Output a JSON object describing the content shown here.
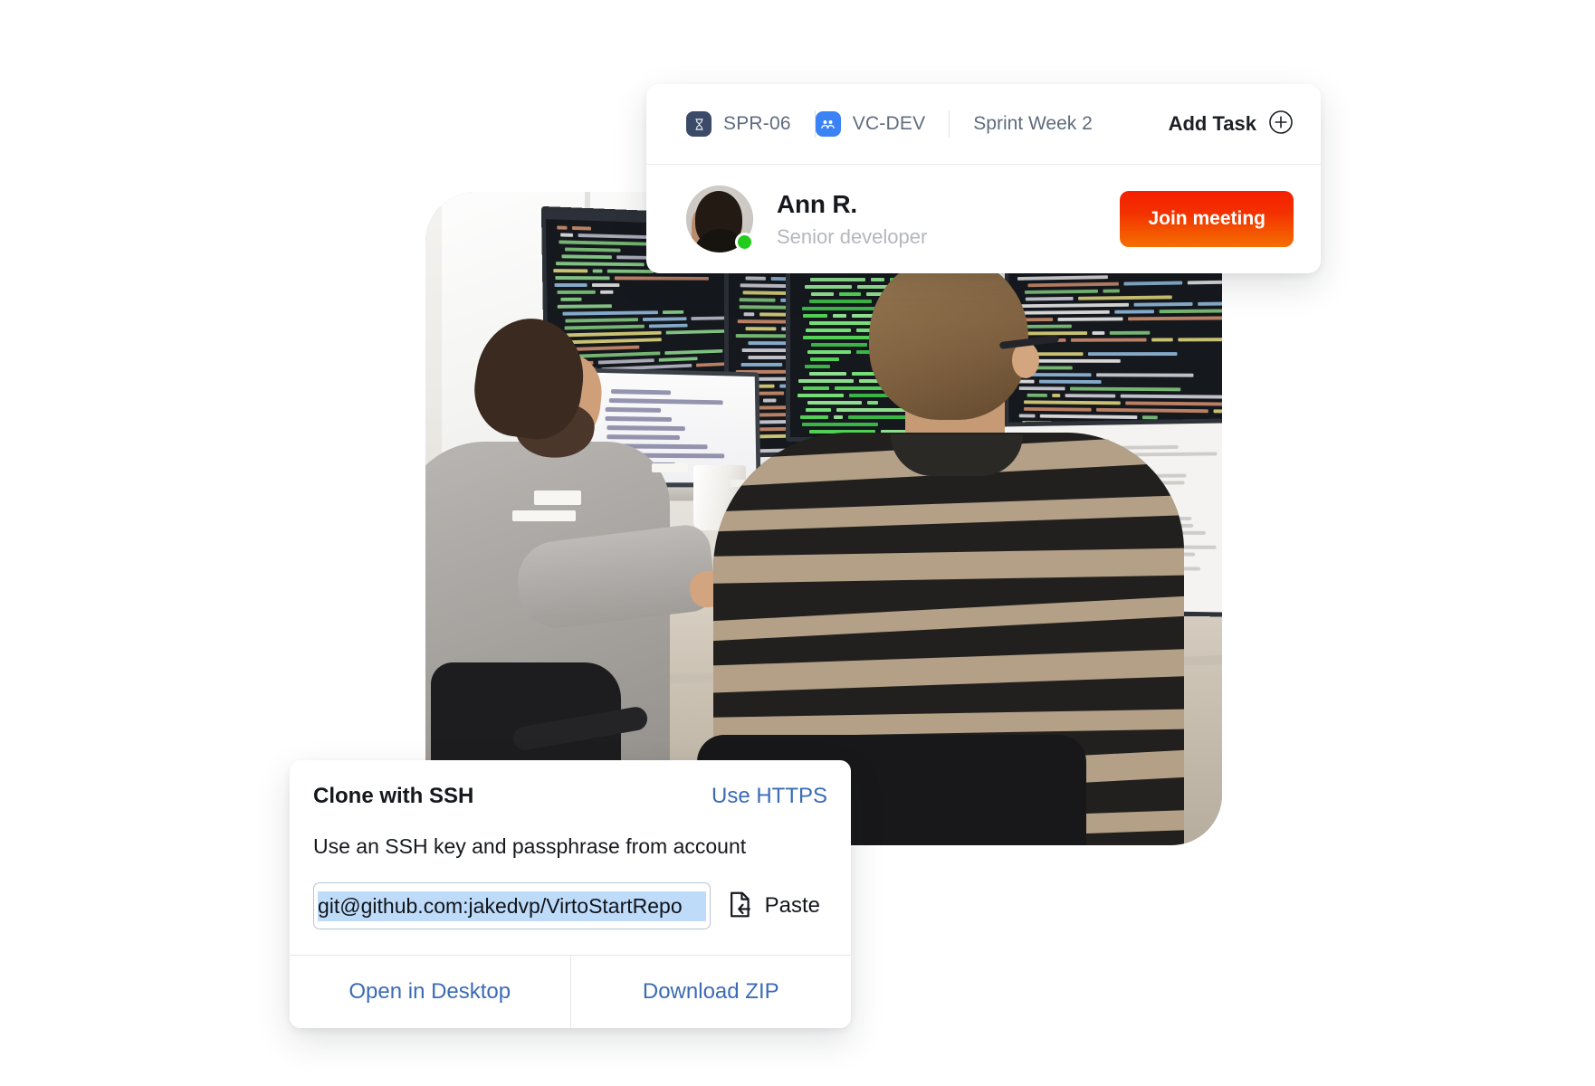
{
  "top_card": {
    "chips": [
      {
        "label": "SPR-06",
        "icon": "hourglass-icon",
        "icon_color": "#3b4a66"
      },
      {
        "label": "VC-DEV",
        "icon": "people-group-icon",
        "icon_color": "#3b82f6"
      }
    ],
    "sprint_label": "Sprint Week 2",
    "add_task_label": "Add Task",
    "add_task_icon": "plus-circle-icon",
    "user": {
      "name": "Ann R.",
      "role": "Senior developer",
      "status": "online",
      "status_color": "#21cc1c",
      "avatar": "user-avatar"
    },
    "join_button": {
      "label": "Join meeting",
      "gradient_from": "#f52000",
      "gradient_to": "#f56f00"
    }
  },
  "ssh_card": {
    "title": "Clone with SSH",
    "toggle_link": "Use HTTPS",
    "description": "Use an SSH key and passphrase from account",
    "url_value": "git@github.com:jakedvp/VirtoStartRepo",
    "url_selected": true,
    "paste_label": "Paste",
    "paste_icon": "paste-icon",
    "footer": {
      "open_desktop": "Open in Desktop",
      "download_zip": "Download ZIP"
    }
  },
  "photo": {
    "alt": "two-developers-at-desk-with-monitors"
  }
}
